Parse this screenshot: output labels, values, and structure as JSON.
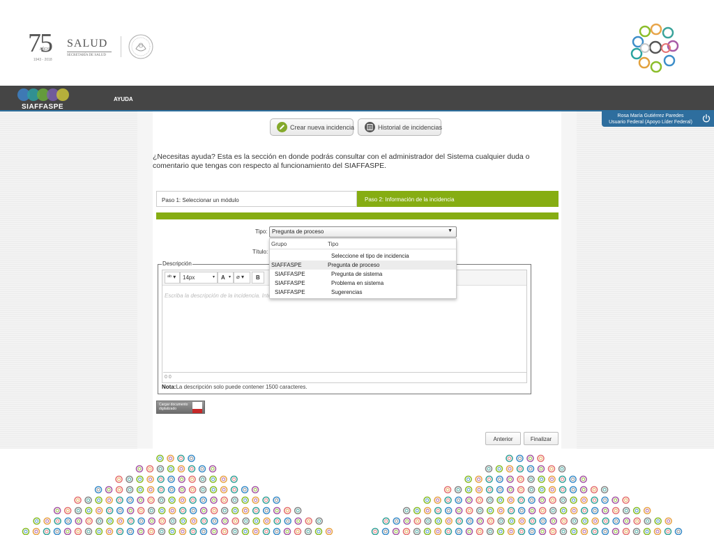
{
  "header": {
    "logo_75": {
      "number": "75",
      "anos": "AÑOS",
      "years": "1943 - 2018"
    },
    "salud": {
      "title": "SALUD",
      "subtitle": "SECRETARÍA DE SALUD"
    }
  },
  "nav": {
    "app_name": "SIAFFASPE",
    "ayuda": "AYUDA"
  },
  "user": {
    "name": "Rosa María Gutiérrez Paredes",
    "role": "Usuario Federal (Apoyo Líder Federal)"
  },
  "actions": {
    "create": "Crear nueva incidencia",
    "history": "Historial de incidencias"
  },
  "intro": "¿Necesitas ayuda? Esta es la sección en donde podrás consultar con el administrador del Sistema cualquier duda o comentario que tengas con respecto al funcionamiento del SIAFFASPE.",
  "steps": {
    "step1": "Paso 1: Seleccionar un módulo",
    "step2": "Paso 2: Información de la incidencia",
    "active": 2
  },
  "form": {
    "tipo_label": "Tipo:",
    "tipo_value": "Pregunta de proceso",
    "titulo_label": "Título:",
    "descripcion_legend": "Descripción",
    "font_size": "14px",
    "bold": "B",
    "font_color": "A",
    "placeholder": "Escriba la descripción de la incidencia. Intente",
    "counter": "0   0",
    "nota_label": "Nota:",
    "nota_text": "La descripción solo puede contener 1500 caracteres.",
    "pdf_label": "Cargar documento digitalizado"
  },
  "dropdown": {
    "headers": [
      "Grupo",
      "Tipo"
    ],
    "placeholder": "Seleccione el tipo de incidencia",
    "rows": [
      {
        "grupo": "SIAFFASPE",
        "tipo": "Pregunta de proceso",
        "selected": true
      },
      {
        "grupo": "SIAFFASPE",
        "tipo": "Pregunta de sistema",
        "selected": false
      },
      {
        "grupo": "SIAFFASPE",
        "tipo": "Problema en sistema",
        "selected": false
      },
      {
        "grupo": "SIAFFASPE",
        "tipo": "Sugerencias",
        "selected": false
      }
    ]
  },
  "buttons": {
    "prev": "Anterior",
    "finish": "Finalizar"
  },
  "colors": {
    "green": "#86ad12",
    "nav": "#454545",
    "blue": "#2e6e9e"
  }
}
